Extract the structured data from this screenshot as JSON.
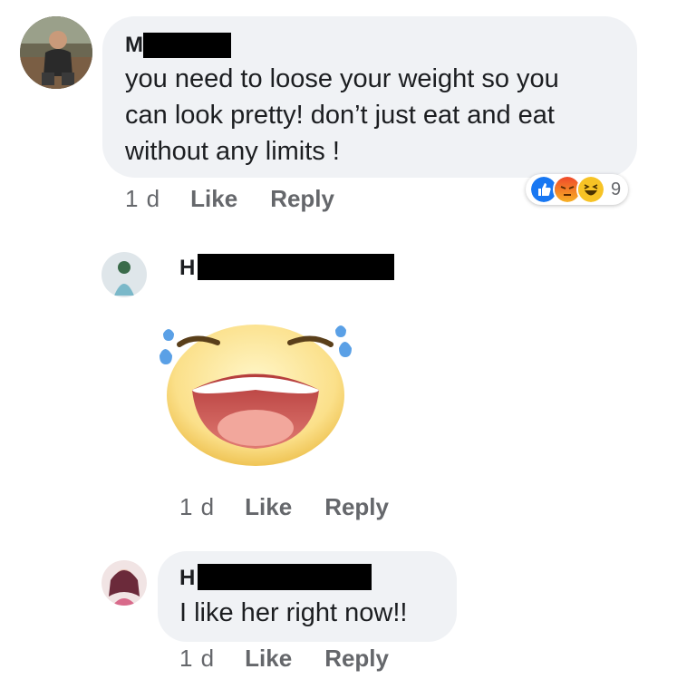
{
  "comments": [
    {
      "author_initial": "M",
      "text_lines": [
        "you need to loose your weight so you",
        "can look pretty! don’t just eat and eat",
        "without any limits !"
      ],
      "time": "1 d",
      "like_label": "Like",
      "reply_label": "Reply",
      "reactions": {
        "icons": [
          "like-icon",
          "angry-icon",
          "haha-icon"
        ],
        "count": "9"
      }
    },
    {
      "author_initial": "H",
      "sticker": "laughing-crying-face-sticker",
      "time": "1 d",
      "like_label": "Like",
      "reply_label": "Reply"
    },
    {
      "author_initial": "H",
      "text": "I like her right now!!",
      "time": "1 d",
      "like_label": "Like",
      "reply_label": "Reply"
    }
  ],
  "colors": {
    "bubble": "#f0f2f5",
    "meta_text": "#65676b",
    "like_blue": "#1877f2",
    "angry_red": "#e9710f",
    "haha_yellow": "#f7b125"
  }
}
